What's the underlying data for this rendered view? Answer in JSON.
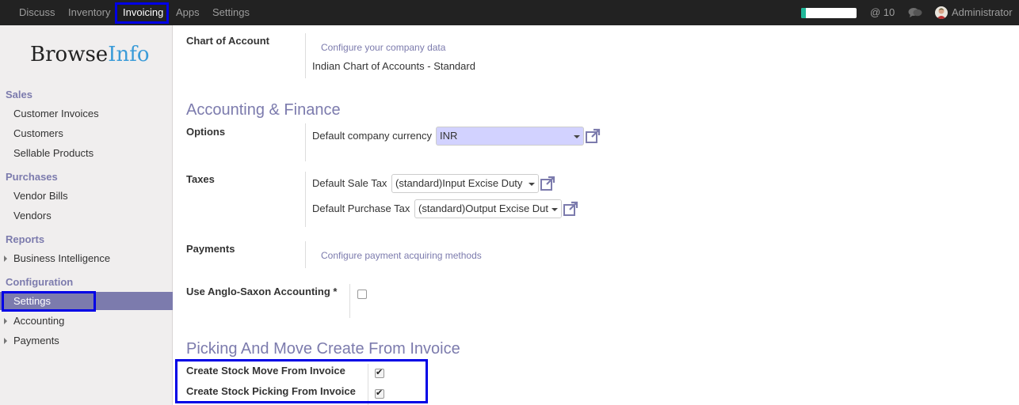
{
  "topbar": {
    "menu": [
      "Discuss",
      "Inventory",
      "Invoicing",
      "Apps",
      "Settings"
    ],
    "active_menu": "Invoicing",
    "progress_fraction": 0.08,
    "mentions": "@ 10",
    "user": "Administrator",
    "icons": {
      "chat": "chat-bubbles-icon",
      "avatar": "user-avatar"
    }
  },
  "sidebar": {
    "logo": {
      "part1": "Browse",
      "part2": "Info"
    },
    "sections": {
      "sales": {
        "title": "Sales",
        "items": [
          "Customer Invoices",
          "Customers",
          "Sellable Products"
        ]
      },
      "purchases": {
        "title": "Purchases",
        "items": [
          "Vendor Bills",
          "Vendors"
        ]
      },
      "reports": {
        "title": "Reports",
        "items": [
          "Business Intelligence"
        ]
      },
      "configuration": {
        "title": "Configuration",
        "items": [
          "Settings",
          "Accounting",
          "Payments"
        ],
        "active": "Settings"
      }
    }
  },
  "main": {
    "chart_of_account": {
      "label": "Chart of Account",
      "link": "Configure your company data",
      "value": "Indian Chart of Accounts - Standard"
    },
    "accounting_heading": "Accounting & Finance",
    "options": {
      "label": "Options",
      "currency_label": "Default company currency",
      "currency_value": "INR"
    },
    "taxes": {
      "label": "Taxes",
      "sale_label": "Default Sale Tax",
      "sale_value": "(standard)Input Excise Duty",
      "purchase_label": "Default Purchase Tax",
      "purchase_value": "(standard)Output Excise Duty"
    },
    "payments": {
      "label": "Payments",
      "link": "Configure payment acquiring methods"
    },
    "anglo_saxon": {
      "label": "Use Anglo-Saxon Accounting *",
      "checked": false
    },
    "picking_heading": "Picking And Move Create From Invoice",
    "stock_move": {
      "label": "Create Stock Move From Invoice",
      "checked": true
    },
    "stock_picking": {
      "label": "Create Stock Picking From Invoice",
      "checked": true
    }
  },
  "colors": {
    "accent": "#7c7bad",
    "topbar": "#222222",
    "highlight_box": "#0000e6",
    "required_field": "#d2d2ff",
    "progress": "#21b799"
  }
}
